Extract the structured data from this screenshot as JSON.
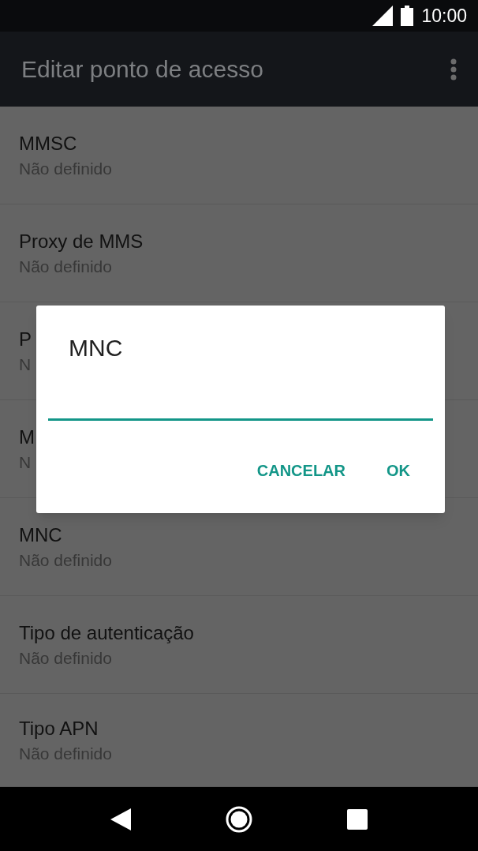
{
  "status_bar": {
    "time": "10:00"
  },
  "app_bar": {
    "title": "Editar ponto de acesso"
  },
  "settings": [
    {
      "title": "MMSC",
      "summary": "Não definido"
    },
    {
      "title": "Proxy de MMS",
      "summary": "Não definido"
    },
    {
      "title": "P",
      "summary": "N"
    },
    {
      "title": "M",
      "summary": "N"
    },
    {
      "title": "MNC",
      "summary": "Não definido"
    },
    {
      "title": "Tipo de autenticação",
      "summary": "Não definido"
    },
    {
      "title": "Tipo APN",
      "summary": "Não definido"
    }
  ],
  "dialog": {
    "title": "MNC",
    "buttons": [
      "CANCELAR",
      "OK"
    ]
  }
}
